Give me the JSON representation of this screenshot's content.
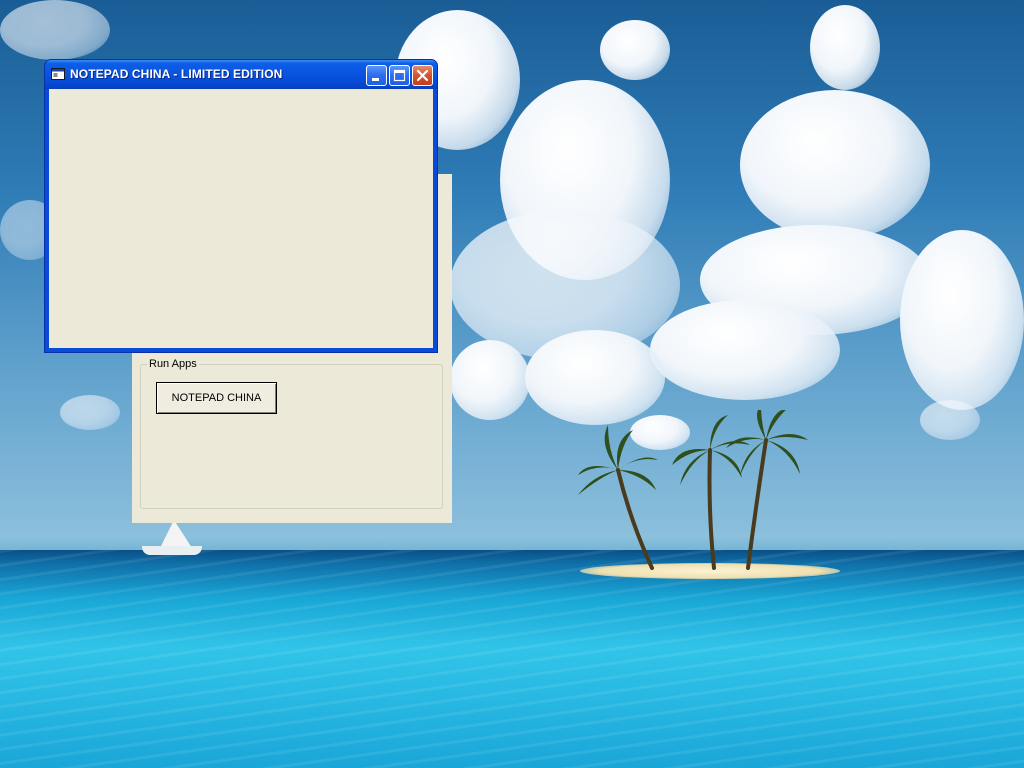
{
  "desktop": {
    "wallpaper": "tropical-island-wallpaper"
  },
  "main_window": {
    "title": "NOTEPAD CHINA - LIMITED EDITION",
    "icon": "app-window-icon",
    "controls": {
      "minimize": "minimize-icon",
      "maximize": "maximize-icon",
      "close": "close-icon"
    },
    "colors": {
      "titlebar": "#0a55e0",
      "client": "#ece9d8",
      "close": "#d6512c"
    }
  },
  "launcher_form": {
    "group_label": "Run Apps",
    "button_label": "NOTEPAD CHINA",
    "colors": {
      "background": "#ece9d8"
    }
  }
}
